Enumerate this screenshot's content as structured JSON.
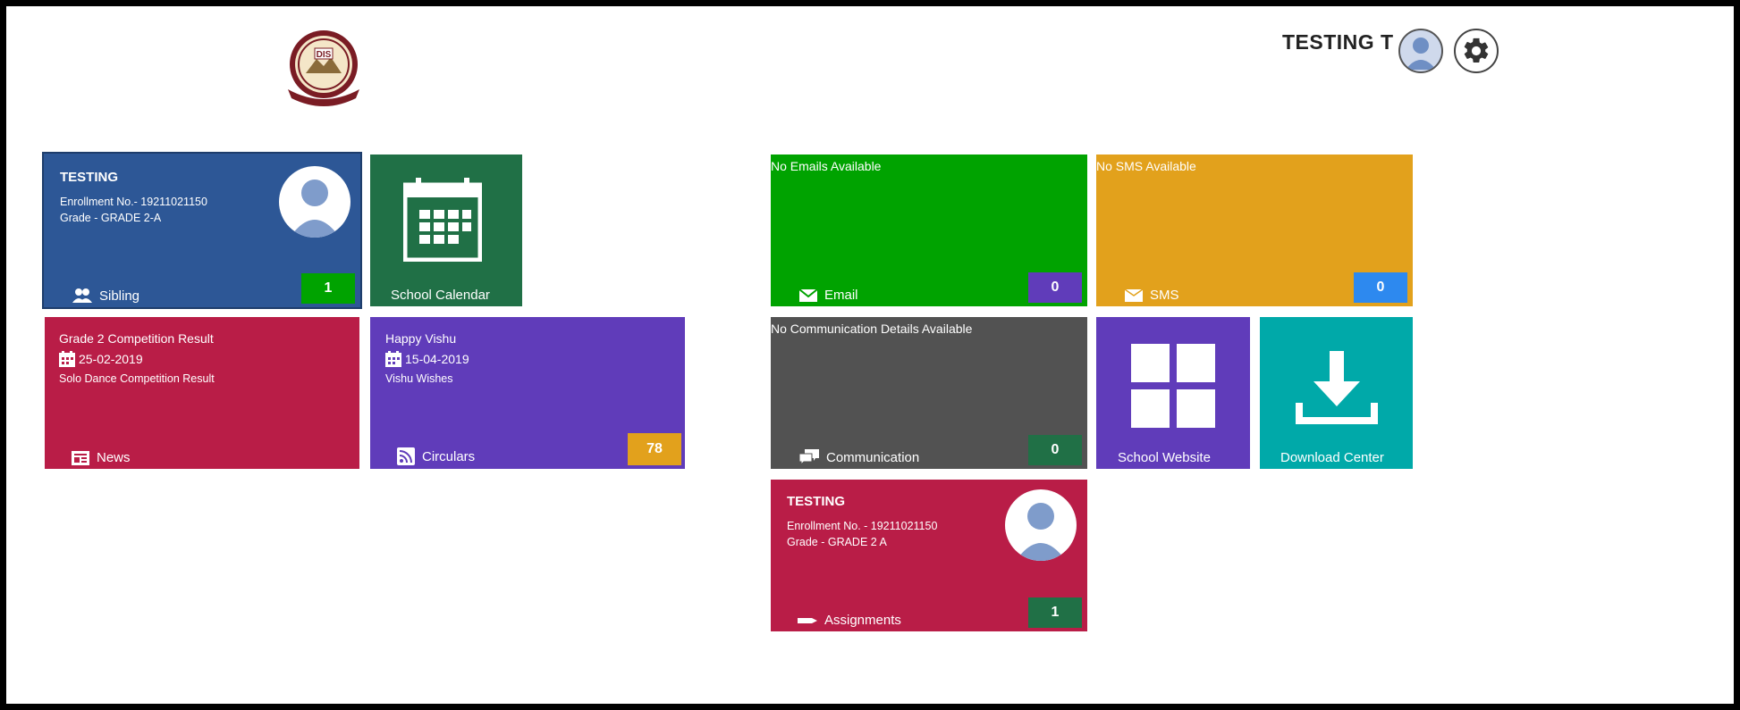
{
  "header": {
    "user_name": "TESTING T",
    "logo_text": "DIS"
  },
  "tiles": {
    "student": {
      "name": "TESTING",
      "enrollment": "Enrollment No.- 19211021150",
      "grade": "Grade - GRADE 2-A",
      "label": "Sibling",
      "badge": "1"
    },
    "calendar": {
      "label": "School Calendar"
    },
    "email": {
      "note": "No Emails Available",
      "label": "Email",
      "badge": "0"
    },
    "sms": {
      "note": "No SMS Available",
      "label": "SMS",
      "badge": "0"
    },
    "news": {
      "title": "Grade 2 Competition Result",
      "date": "25-02-2019",
      "desc": "Solo Dance Competition Result",
      "label": "News"
    },
    "circulars": {
      "title": "Happy Vishu",
      "date": "15-04-2019",
      "desc": "Vishu Wishes",
      "label": "Circulars",
      "badge": "78"
    },
    "communication": {
      "note": "No Communication Details Available",
      "label": "Communication",
      "badge": "0"
    },
    "website": {
      "label": "School Website"
    },
    "download": {
      "label": "Download Center"
    },
    "assignments": {
      "name": "TESTING",
      "enrollment": "Enrollment No. - 19211021150",
      "grade": "Grade - GRADE 2 A",
      "label": "Assignments",
      "badge": "1"
    }
  },
  "colors": {
    "student_blue": "#2d5796",
    "calendar_green": "#207046",
    "email_green": "#00a300",
    "sms_orange": "#e2a11c",
    "news_red": "#b91d47",
    "circulars_purple": "#603cba",
    "communication_gray": "#525252",
    "download_teal": "#00a9a9",
    "badge_dark_green": "#207046",
    "badge_purple": "#603cba",
    "badge_blue": "#2d89ef",
    "badge_green": "#00a300",
    "badge_orange": "#e2a11c"
  }
}
